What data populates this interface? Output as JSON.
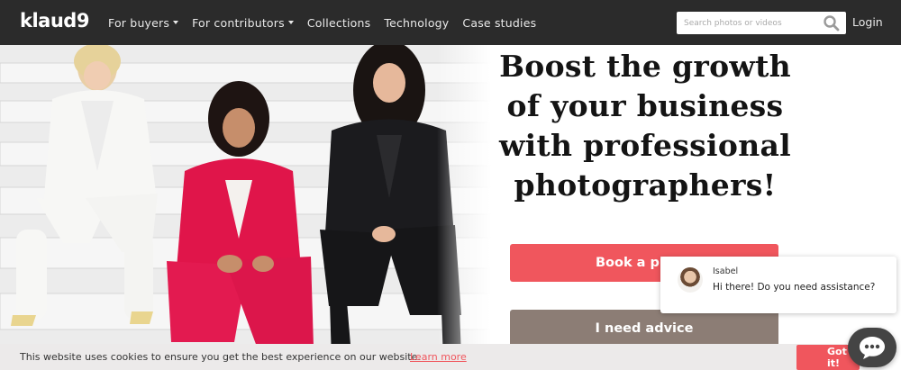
{
  "brand": {
    "logo_text": "klaud",
    "logo_suffix": "9"
  },
  "nav": {
    "items": [
      {
        "label": "For buyers",
        "has_dropdown": true
      },
      {
        "label": "For contributors",
        "has_dropdown": true
      },
      {
        "label": "Collections",
        "has_dropdown": false
      },
      {
        "label": "Technology",
        "has_dropdown": false
      },
      {
        "label": "Case studies",
        "has_dropdown": false
      }
    ],
    "search": {
      "placeholder": "Search photos or videos",
      "value": "",
      "icon": "search-icon"
    },
    "login_label": "Login"
  },
  "hero": {
    "headline": "Boost the growth of your business with professional photographers!",
    "image_subject": "three women in white, pink and black suits sitting on white stairs",
    "book_button_label": "Book a photo",
    "advice_button_label": "I need advice"
  },
  "chat": {
    "agent_name": "Isabel",
    "message": "Hi there! Do you need assistance?",
    "launcher_icon": "chat-bubble-icon"
  },
  "cookie_banner": {
    "text": "This website uses cookies to ensure you get the best experience on our website.",
    "link_label": "Learn more",
    "accept_label": "Got it!"
  },
  "colors": {
    "nav_bg": "#2b2b2b",
    "accent": "#f0565d",
    "secondary_button": "#8c7d75",
    "cookie_bg": "#eceaea",
    "chat_launcher": "#444444"
  }
}
